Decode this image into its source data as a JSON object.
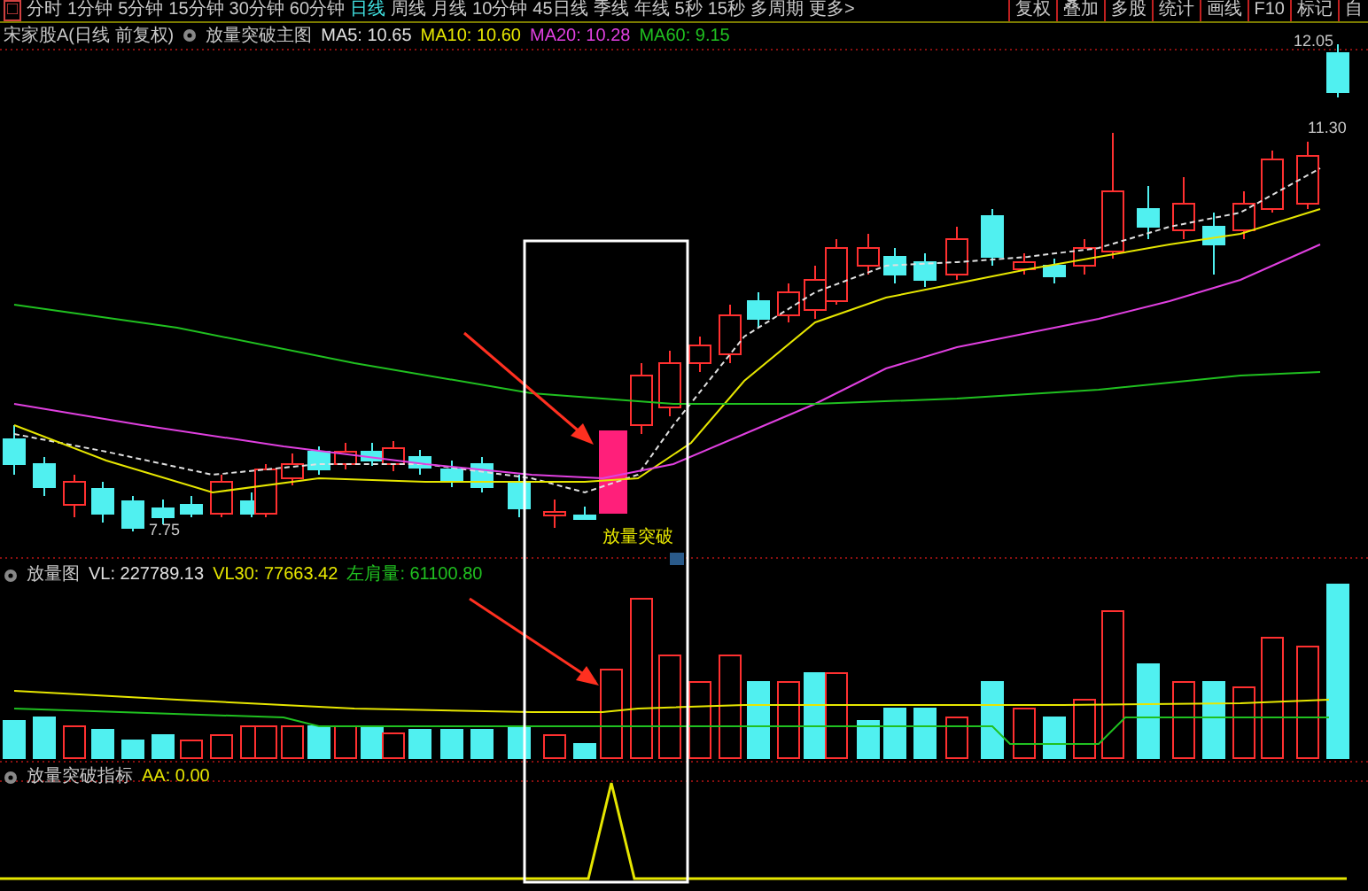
{
  "period_bar": {
    "square_icon": "□",
    "periods": [
      {
        "label": "分时",
        "selected": false
      },
      {
        "label": "1分钟",
        "selected": false
      },
      {
        "label": "5分钟",
        "selected": false
      },
      {
        "label": "15分钟",
        "selected": false
      },
      {
        "label": "30分钟",
        "selected": false
      },
      {
        "label": "60分钟",
        "selected": false
      },
      {
        "label": "日线",
        "selected": true
      },
      {
        "label": "周线",
        "selected": false
      },
      {
        "label": "月线",
        "selected": false
      },
      {
        "label": "10分钟",
        "selected": false
      },
      {
        "label": "45日线",
        "selected": false
      },
      {
        "label": "季线",
        "selected": false
      },
      {
        "label": "年线",
        "selected": false
      },
      {
        "label": "5秒",
        "selected": false
      },
      {
        "label": "15秒",
        "selected": false
      },
      {
        "label": "多周期",
        "selected": false
      },
      {
        "label": "更多>",
        "selected": false
      }
    ],
    "tools": [
      "复权",
      "叠加",
      "多股",
      "统计",
      "画线",
      "F10",
      "标记",
      "自"
    ]
  },
  "main_chart": {
    "title": "宋家股A(日线 前复权)",
    "indicator": "放量突破主图",
    "legend": [
      {
        "text": "MA5: 10.65",
        "color": "#e0e0e0"
      },
      {
        "text": "MA10: 10.60",
        "color": "#e6e600"
      },
      {
        "text": "MA20: 10.28",
        "color": "#e040e0"
      },
      {
        "text": "MA60: 9.15",
        "color": "#20c020"
      }
    ],
    "price_labels": [
      "12.05",
      "11.30",
      "7.75"
    ],
    "signal_label": "放量突破"
  },
  "volume_panel": {
    "indicator": "放量图",
    "legend": [
      {
        "text": "VL: 227789.13",
        "color": "#e0e0e0"
      },
      {
        "text": "VL30: 77663.42",
        "color": "#e6e600"
      },
      {
        "text": "左肩量: 61100.80",
        "color": "#20c020"
      }
    ]
  },
  "signal_panel": {
    "indicator": "放量突破指标",
    "legend": [
      {
        "text": "AA: 0.00",
        "color": "#e6e600"
      }
    ]
  }
}
